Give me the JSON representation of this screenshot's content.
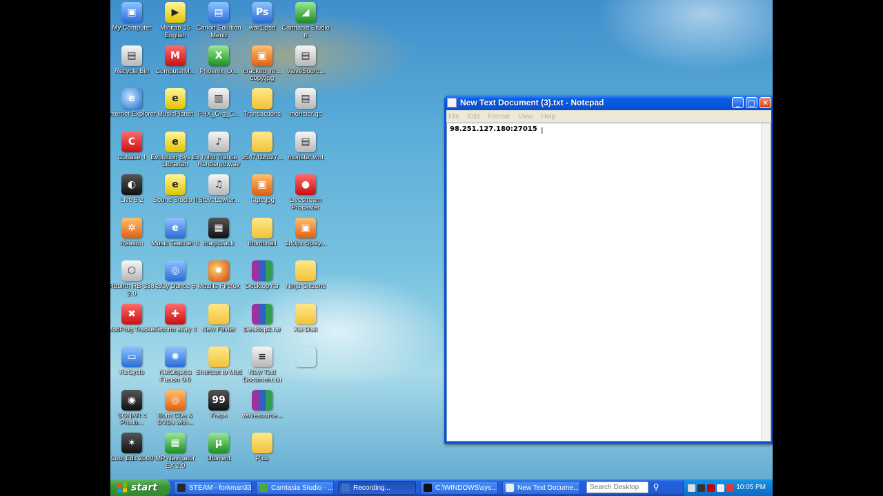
{
  "desktop": {
    "icons": [
      {
        "label": "My Computer",
        "glyph": "computer-icon",
        "g": "g-blue",
        "ch": "▣"
      },
      {
        "label": "Recycle Bin",
        "glyph": "recycle-bin-icon",
        "g": "g-gray",
        "ch": "▤"
      },
      {
        "label": "Internet Explorer",
        "glyph": "internet-explorer-icon",
        "g": "g-ie",
        "ch": "e"
      },
      {
        "label": "Cubase 4",
        "glyph": "cubase-icon",
        "g": "g-red",
        "ch": "C"
      },
      {
        "label": "Live 5.2",
        "glyph": "ableton-live-icon",
        "g": "g-dark",
        "ch": "◐"
      },
      {
        "label": "Reason",
        "glyph": "reason-icon",
        "g": "g-orange",
        "ch": "✲"
      },
      {
        "label": "Rebirth RB-338 2.0",
        "glyph": "rebirth-icon",
        "g": "g-gray",
        "ch": "⬡"
      },
      {
        "label": "ModPlug Tracker",
        "glyph": "modplug-icon",
        "g": "g-red",
        "ch": "✖"
      },
      {
        "label": "ReCycle",
        "glyph": "recycle-app-icon",
        "g": "g-blue",
        "ch": "▭"
      },
      {
        "label": "SONAR 4 Produ...",
        "glyph": "sonar-icon",
        "g": "g-dark",
        "ch": "◉"
      },
      {
        "label": "Cool Edit 2000",
        "glyph": "cool-edit-icon",
        "g": "g-dark",
        "ch": "✶"
      },
      {
        "label": "Minitab 15 English",
        "glyph": "minitab-icon",
        "g": "g-yel",
        "ch": "▶"
      },
      {
        "label": "ComputerM...",
        "glyph": "computer-music-icon",
        "g": "g-red",
        "ch": "M"
      },
      {
        "label": "MusicPlanet",
        "glyph": "musicplanet-icon",
        "g": "g-yel",
        "ch": "e"
      },
      {
        "label": "Evolution Sys Ex Librarian",
        "glyph": "evolution-icon",
        "g": "g-yel",
        "ch": "e"
      },
      {
        "label": "Sound Studio II",
        "glyph": "sound-studio-icon",
        "g": "g-yel",
        "ch": "e"
      },
      {
        "label": "Music Teacher II",
        "glyph": "music-teacher-icon",
        "g": "g-blue",
        "ch": "e"
      },
      {
        "label": "eJay Dance 6",
        "glyph": "ejay-dance-icon",
        "g": "g-blue",
        "ch": "◎"
      },
      {
        "label": "Techno eJay 4",
        "glyph": "techno-ejay-icon",
        "g": "g-red",
        "ch": "✚"
      },
      {
        "label": "NetObjects Fusion 9.0",
        "glyph": "netobjects-icon",
        "g": "g-blue",
        "ch": "✺"
      },
      {
        "label": "Burn CDs & DVDs with...",
        "glyph": "burn-cd-icon",
        "g": "g-orange",
        "ch": "◎"
      },
      {
        "label": "MP Navigator EX 2.0",
        "glyph": "mp-navigator-icon",
        "g": "g-green",
        "ch": "▦"
      },
      {
        "label": "Canon Solution Menu",
        "glyph": "canon-icon",
        "g": "g-blue",
        "ch": "▤"
      },
      {
        "label": "Phoenix_O...",
        "glyph": "excel-file-icon",
        "g": "g-green",
        "ch": "X"
      },
      {
        "label": "PHX_Org_C...",
        "glyph": "document-icon",
        "g": "g-gray",
        "ch": "▥"
      },
      {
        "label": "Third Trance Rendered.wav",
        "glyph": "wav-file-icon",
        "g": "g-gray",
        "ch": "♪"
      },
      {
        "label": "SteveLawler...",
        "glyph": "mp3-file-icon",
        "g": "g-gray",
        "ch": "♫"
      },
      {
        "label": "magicJack",
        "glyph": "magicjack-icon",
        "g": "g-dark",
        "ch": "▦"
      },
      {
        "label": "Mozilla Firefox",
        "glyph": "firefox-icon",
        "g": "g-ff",
        "ch": "✹"
      },
      {
        "label": "New Folder",
        "glyph": "folder-icon",
        "g": "g-fold",
        "ch": ""
      },
      {
        "label": "Shortcut to Mod",
        "glyph": "folder-icon",
        "g": "g-fold",
        "ch": ""
      },
      {
        "label": "Fraps",
        "glyph": "fraps-icon",
        "g": "g-dark",
        "ch": "99"
      },
      {
        "label": "Utorrent",
        "glyph": "utorrent-icon",
        "g": "g-green",
        "ch": "µ"
      },
      {
        "label": "war1.psd",
        "glyph": "photoshop-file-icon",
        "g": "g-blue",
        "ch": "Ps"
      },
      {
        "label": "cracked_re... copy.jpg",
        "glyph": "image-file-icon",
        "g": "g-orange",
        "ch": "▣"
      },
      {
        "label": "Transactions",
        "glyph": "folder-icon",
        "g": "g-fold",
        "ch": ""
      },
      {
        "label": "9547418uz7...",
        "glyph": "folder-icon",
        "g": "g-fold",
        "ch": ""
      },
      {
        "label": "Tape.jpg",
        "glyph": "image-file-icon",
        "g": "g-orange",
        "ch": "▣"
      },
      {
        "label": "thumbnail",
        "glyph": "folder-icon",
        "g": "g-fold",
        "ch": ""
      },
      {
        "label": "Desktop.rar",
        "glyph": "rar-file-icon",
        "g": "g-rar",
        "ch": ""
      },
      {
        "label": "Desktop2.rar",
        "glyph": "rar-file-icon",
        "g": "g-rar",
        "ch": ""
      },
      {
        "label": "New Text Document.txt",
        "glyph": "text-file-icon",
        "g": "g-gray",
        "ch": "≡"
      },
      {
        "label": "valvesource...",
        "glyph": "rar-file-icon",
        "g": "g-rar",
        "ch": ""
      },
      {
        "label": "Pics",
        "glyph": "folder-icon",
        "g": "g-fold",
        "ch": ""
      },
      {
        "label": "Camtasia Studio 6",
        "glyph": "camtasia-icon",
        "g": "g-green",
        "ch": "◢"
      },
      {
        "label": "ValveSourc...",
        "glyph": "document-icon",
        "g": "g-gray",
        "ch": "▤"
      },
      {
        "label": "monster.qc",
        "glyph": "document-icon",
        "g": "g-gray",
        "ch": "▤"
      },
      {
        "label": "monster.vmt",
        "glyph": "document-icon",
        "g": "g-gray",
        "ch": "▤"
      },
      {
        "label": "Livestream Procaster",
        "glyph": "livestream-icon",
        "g": "g-red",
        "ch": "●"
      },
      {
        "label": "180px-Spiky...",
        "glyph": "image-file-icon",
        "g": "g-orange",
        "ch": "▣"
      },
      {
        "label": "Ninja Citizens",
        "glyph": "folder-icon",
        "g": "g-fold",
        "ch": ""
      },
      {
        "label": "Xsi Disk",
        "glyph": "folder-icon",
        "g": "g-fold",
        "ch": ""
      }
    ]
  },
  "notepad": {
    "title": "New Text Document (3).txt - Notepad",
    "menu": [
      "File",
      "Edit",
      "Format",
      "View",
      "Help"
    ],
    "content": "98.251.127.180:27015"
  },
  "taskbar": {
    "start_label": "start",
    "tasks": [
      {
        "label": "STEAM - forkman33",
        "color": "#2a2a2a",
        "active": false
      },
      {
        "label": "Camtasia Studio - ...",
        "color": "#4caa3a",
        "active": false
      },
      {
        "label": "Recording...",
        "color": "#3f6fc0",
        "active": true
      },
      {
        "label": "C:\\WINDOWS\\sys...",
        "color": "#111111",
        "active": false
      },
      {
        "label": "New Text Docume...",
        "color": "#e8eef8",
        "active": false
      }
    ],
    "search_placeholder": "Search Desktop",
    "clock": "10:05 PM"
  },
  "colors": {
    "taskbar_blue": "#245edb",
    "start_green": "#3c963c",
    "title_blue": "#0854dc"
  }
}
